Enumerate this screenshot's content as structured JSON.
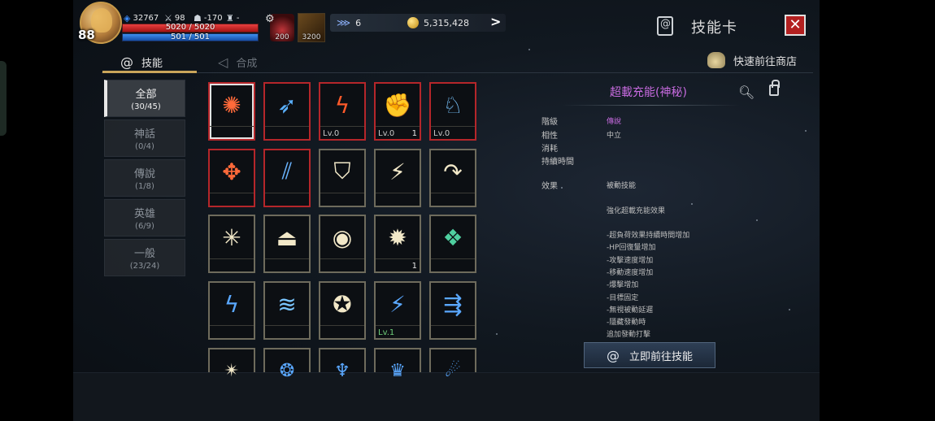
{
  "player": {
    "level": "88",
    "power": "32767",
    "attack": "98",
    "defense": "-170",
    "trophy": "-",
    "hp": "5020 / 5020",
    "mp": "501 / 501"
  },
  "quickslots": {
    "potion_count": "200",
    "item_count": "3200"
  },
  "currency": {
    "wings": "6",
    "gold": "5,315,428"
  },
  "header": {
    "title": "技能卡",
    "close": "✕"
  },
  "tabs": [
    {
      "label": "技能"
    },
    {
      "label": "合成"
    }
  ],
  "shop_link": "快速前往商店",
  "categories": [
    {
      "label": "全部",
      "count": "(30/45)"
    },
    {
      "label": "神話",
      "count": "(0/4)"
    },
    {
      "label": "傳說",
      "count": "(1/8)"
    },
    {
      "label": "英雄",
      "count": "(6/9)"
    },
    {
      "label": "一般",
      "count": "(23/24)"
    }
  ],
  "grid": {
    "rows": [
      [
        {
          "lv": "",
          "cnt": ""
        },
        {
          "lv": "",
          "cnt": ""
        },
        {
          "lv": "Lv.0",
          "cnt": ""
        },
        {
          "lv": "Lv.0",
          "cnt": "1"
        },
        {
          "lv": "Lv.0",
          "cnt": ""
        }
      ],
      [
        {
          "lv": "",
          "cnt": ""
        },
        {
          "lv": "",
          "cnt": ""
        },
        {
          "lv": "",
          "cnt": ""
        },
        {
          "lv": "",
          "cnt": ""
        },
        {
          "lv": "",
          "cnt": ""
        }
      ],
      [
        {
          "lv": "",
          "cnt": ""
        },
        {
          "lv": "",
          "cnt": ""
        },
        {
          "lv": "",
          "cnt": ""
        },
        {
          "lv": "",
          "cnt": "1"
        },
        {
          "lv": "",
          "cnt": ""
        }
      ],
      [
        {
          "lv": "",
          "cnt": ""
        },
        {
          "lv": "",
          "cnt": ""
        },
        {
          "lv": "",
          "cnt": ""
        },
        {
          "lv": "Lv.1",
          "cnt": ""
        },
        {
          "lv": "",
          "cnt": ""
        }
      ]
    ]
  },
  "details": {
    "name": "超載充能(神秘)",
    "rarity_label": "階級",
    "rarity": "傳說",
    "affinity_label": "相性",
    "affinity": "中立",
    "cost_label": "消耗",
    "duration_label": "持續時間",
    "effect_label": "效果",
    "effect": "被動技能",
    "desc_intro": "強化超載充能效果",
    "bullets": [
      "-超負荷效果持續時間增加",
      "-HP回復量增加",
      "-攻擊速度增加",
      "-移動速度增加",
      "-爆擊增加",
      "-目標固定",
      "-無視被動延遲",
      "-隱藏發動時",
      "追加發動打擊"
    ],
    "button": "立即前往技能"
  },
  "colors": {
    "accent_gold": "#c9a55a",
    "rarity_purple": "#c86be0",
    "close_red": "#b32020",
    "legendary_border": "#b5262a"
  }
}
